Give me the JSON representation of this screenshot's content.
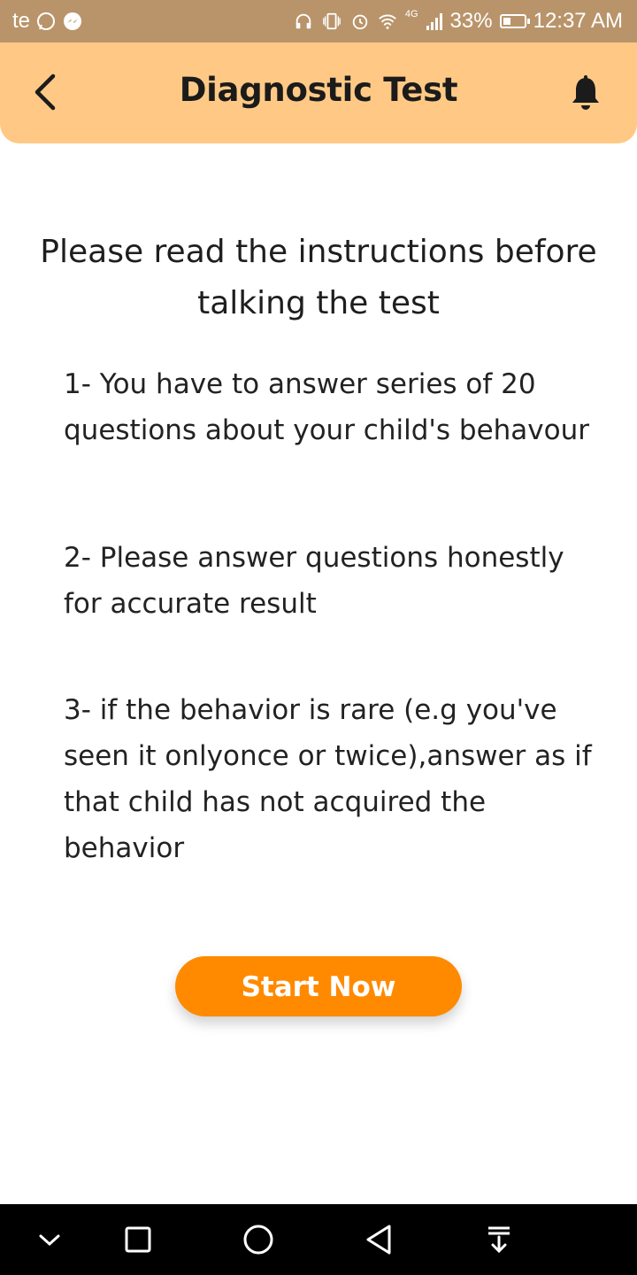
{
  "status_bar": {
    "carrier": "te",
    "network": "4G",
    "battery": "33%",
    "battery_level": 0.33,
    "time": "12:37 AM"
  },
  "app_bar": {
    "title": "Diagnostic Test",
    "background": "#ffc985"
  },
  "content": {
    "heading": "Please read the instructions before talking the test",
    "instructions": [
      "1- You have to answer series of 20 questions about your child's behavour",
      "2- Please answer questions honestly for accurate result",
      "3- if the behavior is rare (e.g you've seen it onlyonce or twice),answer as if that child has not acquired the behavior"
    ]
  },
  "start_button": {
    "label": "Start Now",
    "color": "#ff8a00"
  },
  "nav_bar": {
    "icons": [
      "chevron-down-icon",
      "square-icon",
      "circle-icon",
      "triangle-back-icon",
      "download-icon"
    ]
  }
}
